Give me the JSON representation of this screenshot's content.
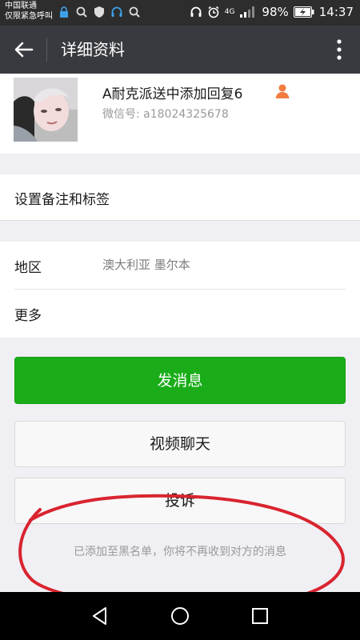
{
  "status_bar": {
    "carrier_line1": "中国联通",
    "carrier_line2": "仅限紧急呼叫",
    "network": "4G",
    "battery": "98%",
    "time": "14:37",
    "icons": [
      "lock-icon",
      "search-icon",
      "shield-icon",
      "headset-icon",
      "search-icon",
      "headphones-icon",
      "alarm-icon",
      "signal-icon",
      "battery-icon"
    ]
  },
  "header": {
    "title": "详细资料",
    "back_icon": "arrow-left-icon",
    "menu_icon": "more-vertical-icon"
  },
  "profile": {
    "name": "A耐克派送中添加回复6",
    "wechat_id": "微信号: a18024325678",
    "badge_icon": "person-icon",
    "badge_color": "#f37b40"
  },
  "remark": {
    "label": "设置备注和标签"
  },
  "info": {
    "region_label": "地区",
    "region_value": "澳大利亚  墨尔本",
    "more_label": "更多"
  },
  "actions": {
    "send_message": "发消息",
    "video_chat": "视频聊天",
    "report": "投诉"
  },
  "notice": "已添加至黑名单，你将不再收到对方的消息",
  "colors": {
    "primary_green": "#1aad19",
    "toolbar": "#393a3f",
    "annotation_red": "#d9242f"
  },
  "nav": {
    "back": "nav-back-icon",
    "home": "nav-home-icon",
    "recents": "nav-recents-icon"
  }
}
